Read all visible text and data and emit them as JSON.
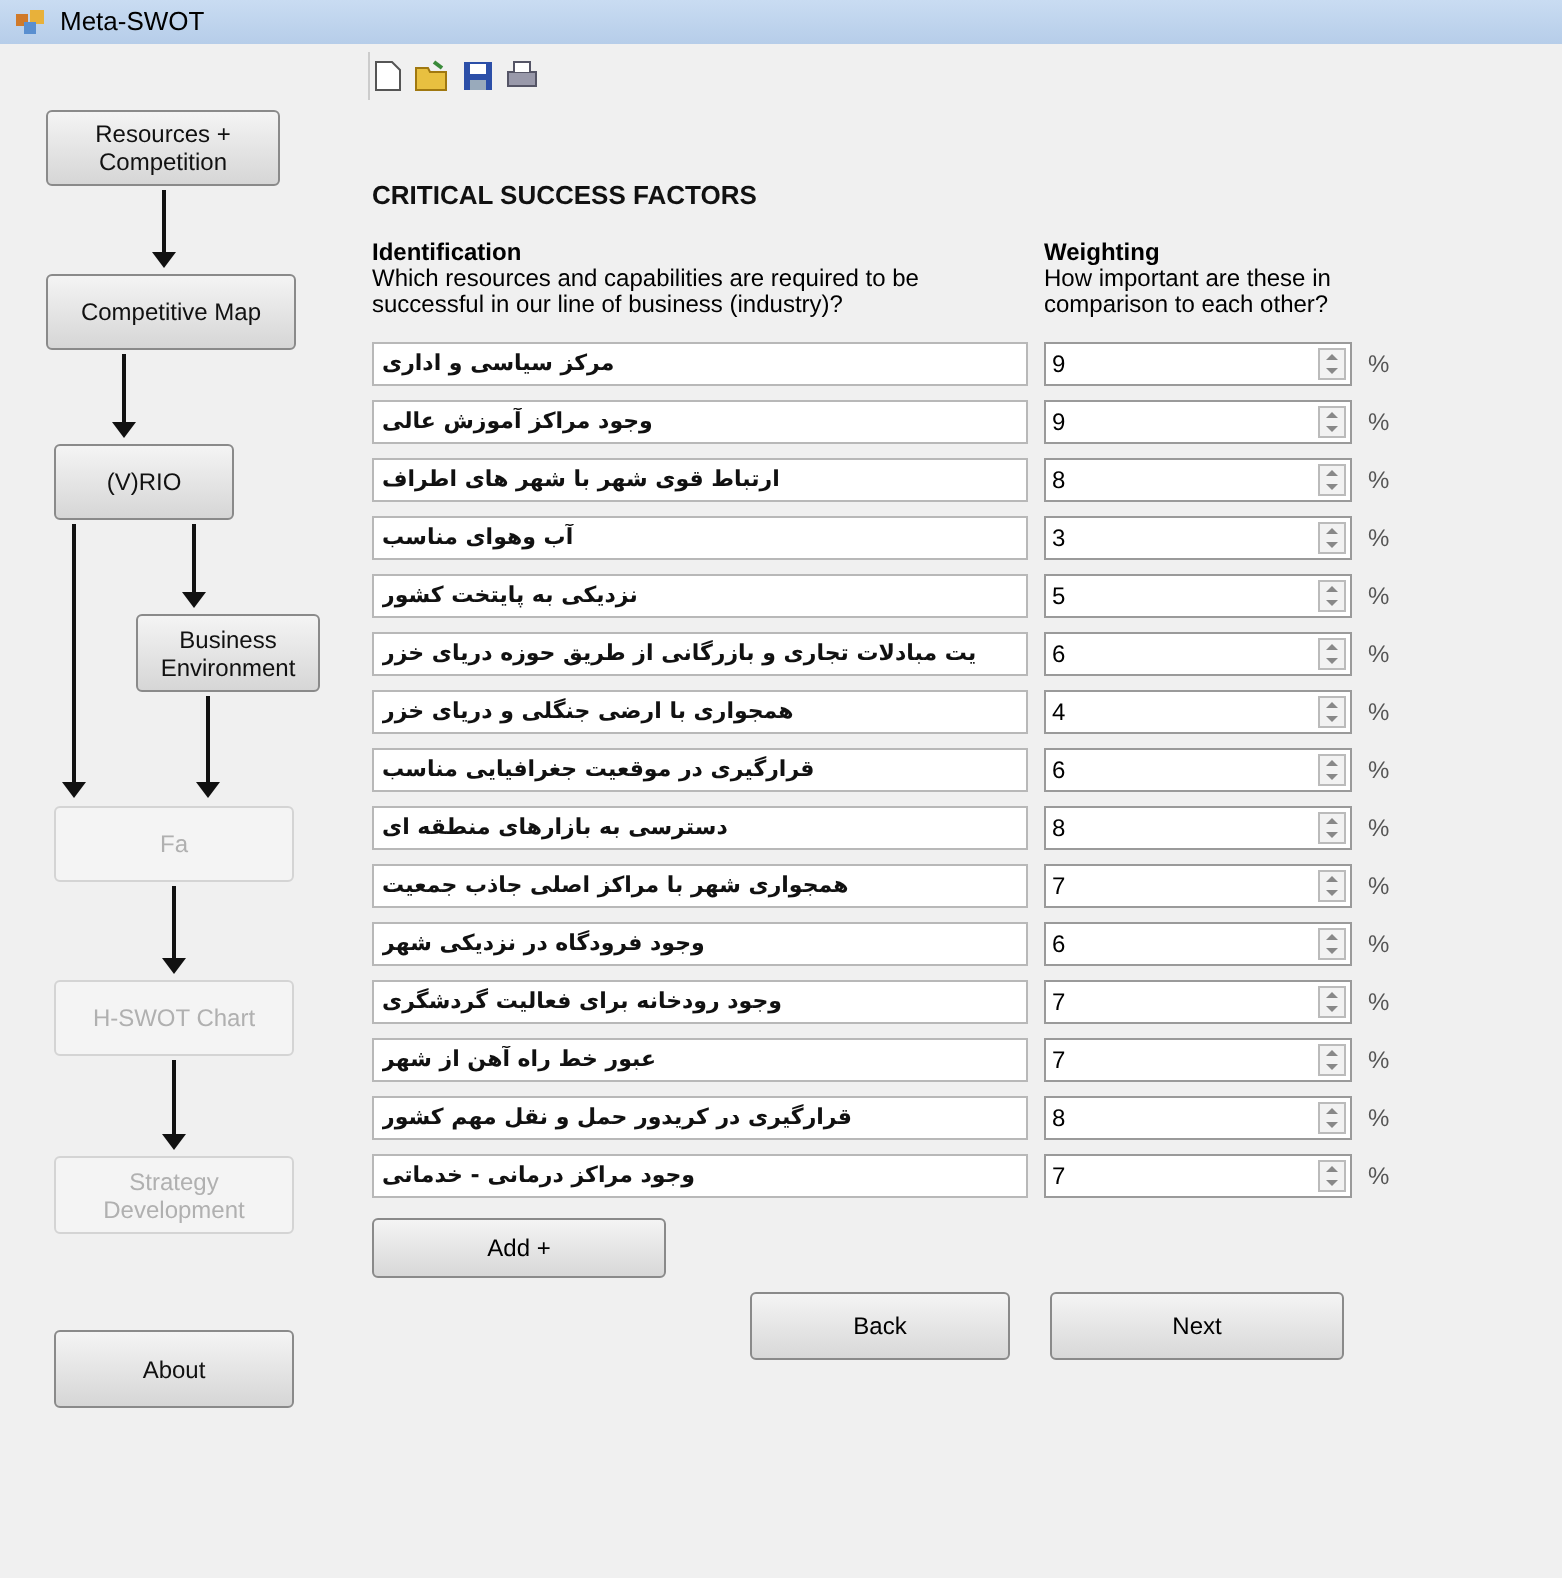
{
  "window": {
    "title": "Meta-SWOT"
  },
  "sidebar": {
    "steps": [
      {
        "label": "Resources + Competition",
        "disabled": false
      },
      {
        "label": "Competitive Map",
        "disabled": false
      },
      {
        "label": "(V)RIO",
        "disabled": false
      },
      {
        "label": "Business Environment",
        "disabled": false
      },
      {
        "label": "Fa",
        "disabled": true
      },
      {
        "label": "H-SWOT Chart",
        "disabled": true
      },
      {
        "label": "Strategy Development",
        "disabled": true
      },
      {
        "label": "About",
        "disabled": false
      }
    ]
  },
  "heading": "CRITICAL SUCCESS FACTORS",
  "identification": {
    "title": "Identification",
    "description": "Which resources and capabilities are required to be successful in our line of business (industry)?"
  },
  "weighting": {
    "title": "Weighting",
    "description": "How important are these in comparison to each other?"
  },
  "factors": [
    {
      "text": "مرکز سیاسی و اداری",
      "weight": "9",
      "unit": "%"
    },
    {
      "text": "وجود مراکز آموزش عالی",
      "weight": "9",
      "unit": "%"
    },
    {
      "text": "ارتباط قوی شهر با شهر های اطراف",
      "weight": "8",
      "unit": "%"
    },
    {
      "text": "آب وهوای مناسب",
      "weight": "3",
      "unit": "%"
    },
    {
      "text": "نزدیکی به پایتخت کشور",
      "weight": "5",
      "unit": "%"
    },
    {
      "text": "یت مبادلات تجاری و بازرگانی از طریق حوزه دریای خزر",
      "weight": "6",
      "unit": "%"
    },
    {
      "text": "همجواری با ارضی جنگلی و دریای خزر",
      "weight": "4",
      "unit": "%"
    },
    {
      "text": "قرارگیری در موقعیت جغرافیایی مناسب",
      "weight": "6",
      "unit": "%"
    },
    {
      "text": "دسترسی به بازارهای منطقه ای",
      "weight": "8",
      "unit": "%"
    },
    {
      "text": "همجواری شهر با مراکز اصلی جاذب جمعیت",
      "weight": "7",
      "unit": "%"
    },
    {
      "text": "وجود فرودگاه در نزدیکی شهر",
      "weight": "6",
      "unit": "%"
    },
    {
      "text": "وجود رودخانه برای فعالیت گردشگری",
      "weight": "7",
      "unit": "%"
    },
    {
      "text": "عبور خط راه آهن از شهر",
      "weight": "7",
      "unit": "%"
    },
    {
      "text": "قرارگیری در کریدور حمل و نقل مهم کشور",
      "weight": "8",
      "unit": "%"
    },
    {
      "text": "وجود مراکز درمانی - خدماتی",
      "weight": "7",
      "unit": "%"
    }
  ],
  "buttons": {
    "add": "Add +",
    "back": "Back",
    "next": "Next"
  }
}
